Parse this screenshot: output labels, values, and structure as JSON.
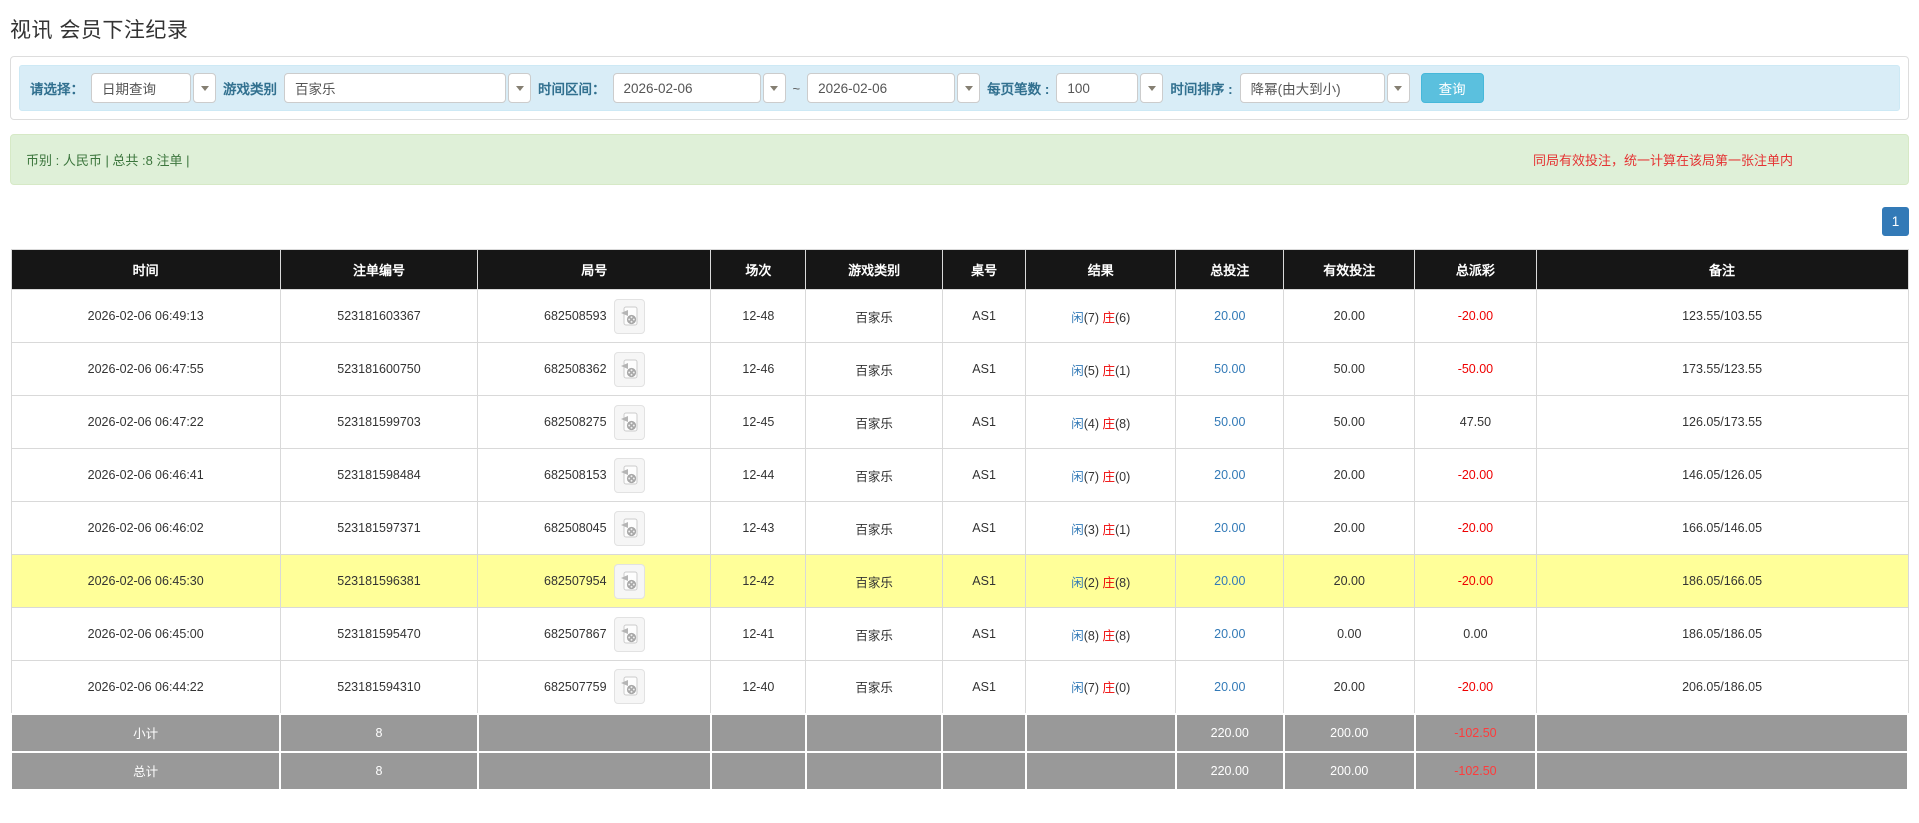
{
  "page": {
    "title": "视讯 会员下注纪录"
  },
  "filters": {
    "select_label": "请选择：",
    "select_value": "日期查询",
    "game_type_label": "游戏类别",
    "game_type_value": "百家乐",
    "time_range_label": "时间区间：",
    "date_from": "2026-02-06",
    "tilde": "~",
    "date_to": "2026-02-06",
    "page_size_label": "每页笔数 :",
    "page_size_value": "100",
    "sort_label": "时间排序 :",
    "sort_value": "降幂(由大到小)",
    "search_button": "查询"
  },
  "summary": {
    "left_text": "币别 : 人民币 | 总共 :8 注单 |",
    "right_notice": "同局有效投注，统一计算在该局第一张注单内"
  },
  "pagination": {
    "current": "1"
  },
  "table": {
    "headers": [
      "时间",
      "注单编号",
      "局号",
      "场次",
      "游戏类别",
      "桌号",
      "结果",
      "总投注",
      "有效投注",
      "总派彩",
      "备注"
    ],
    "result_labels": {
      "player": "闲",
      "banker": "庄"
    },
    "rows": [
      {
        "time": "2026-02-06 06:49:13",
        "bet_id": "523181603367",
        "round_id": "682508593",
        "session": "12-48",
        "game_type": "百家乐",
        "table_no": "AS1",
        "player": "7",
        "banker": "6",
        "total_bet": "20.00",
        "valid_bet": "20.00",
        "payout": "-20.00",
        "note": "123.55/103.55",
        "highlighted": false
      },
      {
        "time": "2026-02-06 06:47:55",
        "bet_id": "523181600750",
        "round_id": "682508362",
        "session": "12-46",
        "game_type": "百家乐",
        "table_no": "AS1",
        "player": "5",
        "banker": "1",
        "total_bet": "50.00",
        "valid_bet": "50.00",
        "payout": "-50.00",
        "note": "173.55/123.55",
        "highlighted": false
      },
      {
        "time": "2026-02-06 06:47:22",
        "bet_id": "523181599703",
        "round_id": "682508275",
        "session": "12-45",
        "game_type": "百家乐",
        "table_no": "AS1",
        "player": "4",
        "banker": "8",
        "total_bet": "50.00",
        "valid_bet": "50.00",
        "payout": "47.50",
        "note": "126.05/173.55",
        "highlighted": false
      },
      {
        "time": "2026-02-06 06:46:41",
        "bet_id": "523181598484",
        "round_id": "682508153",
        "session": "12-44",
        "game_type": "百家乐",
        "table_no": "AS1",
        "player": "7",
        "banker": "0",
        "total_bet": "20.00",
        "valid_bet": "20.00",
        "payout": "-20.00",
        "note": "146.05/126.05",
        "highlighted": false
      },
      {
        "time": "2026-02-06 06:46:02",
        "bet_id": "523181597371",
        "round_id": "682508045",
        "session": "12-43",
        "game_type": "百家乐",
        "table_no": "AS1",
        "player": "3",
        "banker": "1",
        "total_bet": "20.00",
        "valid_bet": "20.00",
        "payout": "-20.00",
        "note": "166.05/146.05",
        "highlighted": false
      },
      {
        "time": "2026-02-06 06:45:30",
        "bet_id": "523181596381",
        "round_id": "682507954",
        "session": "12-42",
        "game_type": "百家乐",
        "table_no": "AS1",
        "player": "2",
        "banker": "8",
        "total_bet": "20.00",
        "valid_bet": "20.00",
        "payout": "-20.00",
        "note": "186.05/166.05",
        "highlighted": true
      },
      {
        "time": "2026-02-06 06:45:00",
        "bet_id": "523181595470",
        "round_id": "682507867",
        "session": "12-41",
        "game_type": "百家乐",
        "table_no": "AS1",
        "player": "8",
        "banker": "8",
        "total_bet": "20.00",
        "valid_bet": "0.00",
        "payout": "0.00",
        "note": "186.05/186.05",
        "highlighted": false
      },
      {
        "time": "2026-02-06 06:44:22",
        "bet_id": "523181594310",
        "round_id": "682507759",
        "session": "12-40",
        "game_type": "百家乐",
        "table_no": "AS1",
        "player": "7",
        "banker": "0",
        "total_bet": "20.00",
        "valid_bet": "20.00",
        "payout": "-20.00",
        "note": "206.05/186.05",
        "highlighted": false
      }
    ],
    "subtotal": {
      "label": "小计",
      "count": "8",
      "total_bet": "220.00",
      "valid_bet": "200.00",
      "payout": "-102.50"
    },
    "grand_total": {
      "label": "总计",
      "count": "8",
      "total_bet": "220.00",
      "valid_bet": "200.00",
      "payout": "-102.50"
    }
  },
  "colors": {
    "accent_blue": "#337ab7",
    "negative_red": "#ee0000",
    "highlight_yellow": "#ffff99",
    "filter_bg": "#d9edf7",
    "alert_bg": "#dff0d8",
    "header_bg": "#161616",
    "totals_bg": "#999999",
    "search_button_bg": "#5bc0de"
  }
}
